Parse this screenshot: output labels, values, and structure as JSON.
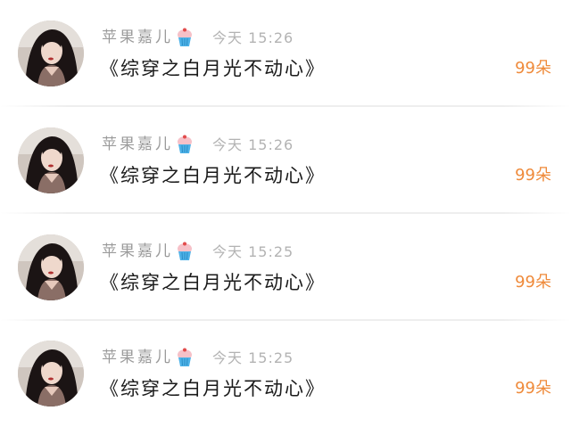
{
  "messages": [
    {
      "avatar_icon": "user-avatar-photo",
      "username": "苹果嘉儿",
      "badge_icon": "cupcake-icon",
      "time": "今天 15:26",
      "message": "《综穿之白月光不动心》",
      "gift_count": "99朵"
    },
    {
      "avatar_icon": "user-avatar-photo",
      "username": "苹果嘉儿",
      "badge_icon": "cupcake-icon",
      "time": "今天 15:26",
      "message": "《综穿之白月光不动心》",
      "gift_count": "99朵"
    },
    {
      "avatar_icon": "user-avatar-photo",
      "username": "苹果嘉儿",
      "badge_icon": "cupcake-icon",
      "time": "今天 15:25",
      "message": "《综穿之白月光不动心》",
      "gift_count": "99朵"
    },
    {
      "avatar_icon": "user-avatar-photo",
      "username": "苹果嘉儿",
      "badge_icon": "cupcake-icon",
      "time": "今天 15:25",
      "message": "《综穿之白月光不动心》",
      "gift_count": "99朵"
    }
  ],
  "colors": {
    "username": "#9b9b9b",
    "time": "#b3b3b3",
    "message": "#1a1a1a",
    "gift_count": "#ef8a3a"
  }
}
